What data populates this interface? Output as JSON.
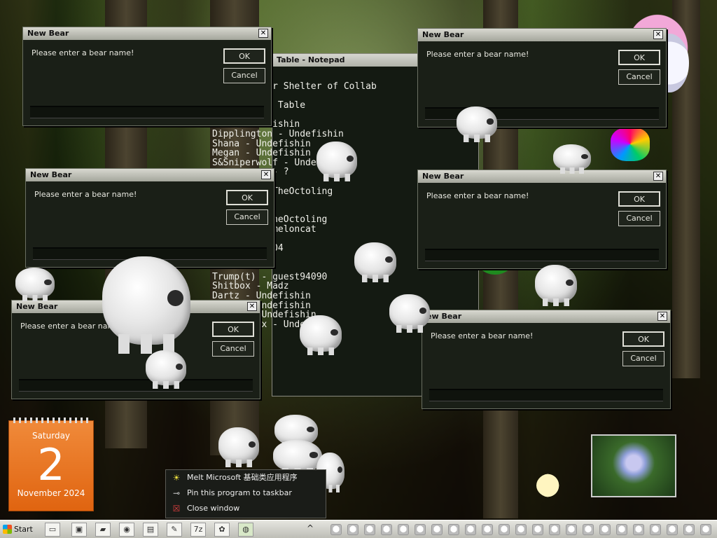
{
  "dialogs": [
    {
      "title": "New Bear",
      "prompt": "Please enter a bear name!",
      "ok": "OK",
      "cancel": "Cancel"
    },
    {
      "title": "New Bear",
      "prompt": "Please enter a bear name!",
      "ok": "OK",
      "cancel": "Cancel"
    },
    {
      "title": "New Bear",
      "prompt": "Please enter a bear name!",
      "ok": "OK",
      "cancel": "Cancel"
    },
    {
      "title": "New Bear",
      "prompt": "Please enter a bear name!",
      "ok": "OK",
      "cancel": "Cancel"
    },
    {
      "title": "New Bear",
      "prompt": "Please enter a bear name!",
      "ok": "OK",
      "cancel": "Cancel"
    },
    {
      "title": "ew Bear",
      "prompt": "Please enter a bear name!",
      "ok": "OK",
      "cancel": "Cancel"
    }
  ],
  "notepad": {
    "title": "Table - Notepad",
    "text": "    The Bear Shelter of Collab\n\n    Shelter Table\n    Fishin\n    - Undefishin\nDipplington - Undefishin\nShana - Undefishin\nMegan - Undefishin\nS&Sniperwolf - Unde\n           - ?\n    lol2456\n    SylveonTheOctoling\n    fishin\n    nard01\n    ylveonTheOctoling\n    - watermeloncat\n    ol2456\n    litchy404\n    x\n\nTrump(t) - guest94090\nShitbox - Madz\nDartz - Undefishin\nDrake - Undefishin\n    UR - Undefishin\n    den xx - Undefishin"
  },
  "calendar": {
    "weekday": "Saturday",
    "day": "2",
    "month_year": "November 2024"
  },
  "context_menu": [
    {
      "label": "Melt Microsoft 基础类应用程序",
      "icon": "melt-icon"
    },
    {
      "label": "Pin this program to taskbar",
      "icon": "pin-icon"
    },
    {
      "label": "Close window",
      "icon": "close-window-icon"
    }
  ],
  "taskbar": {
    "start_label": "Start",
    "pinned": [
      "app-icon",
      "window-icon",
      "folder-icon",
      "ie-icon",
      "notepad-icon",
      "notes-icon",
      "7zip-icon",
      "paint-icon",
      "bear-app-icon"
    ],
    "tray_chevron": "^"
  }
}
